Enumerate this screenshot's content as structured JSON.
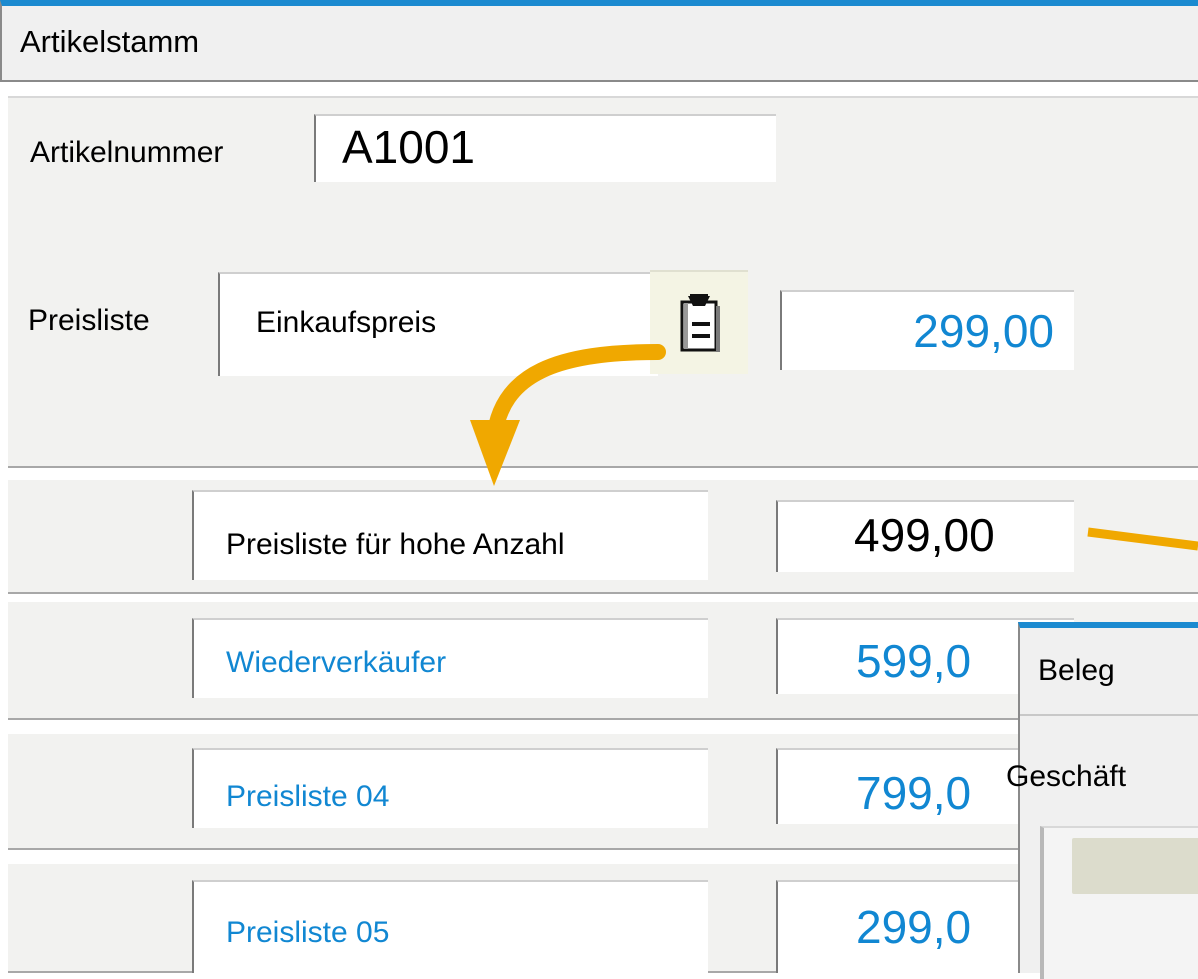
{
  "window": {
    "title": "Artikelstamm"
  },
  "artikel": {
    "label": "Artikelnummer",
    "value": "A1001"
  },
  "preisliste": {
    "label": "Preisliste",
    "selected": "Einkaufspreis",
    "price": "299,00",
    "picker_icon": "clipboard-list-icon"
  },
  "rows": [
    {
      "name": "Preisliste für hohe Anzahl",
      "price": "499,00"
    },
    {
      "name": "Wiederverkäufer",
      "price": "599,0"
    },
    {
      "name": "Preisliste 04",
      "price": "799,0"
    },
    {
      "name": "Preisliste 05",
      "price": "299,0"
    }
  ],
  "beleg": {
    "title": "Beleg",
    "label": "Geschäft"
  },
  "colors": {
    "accent": "#1b8ad0",
    "value_blue": "#1187d2",
    "arrow": "#f0a800"
  }
}
